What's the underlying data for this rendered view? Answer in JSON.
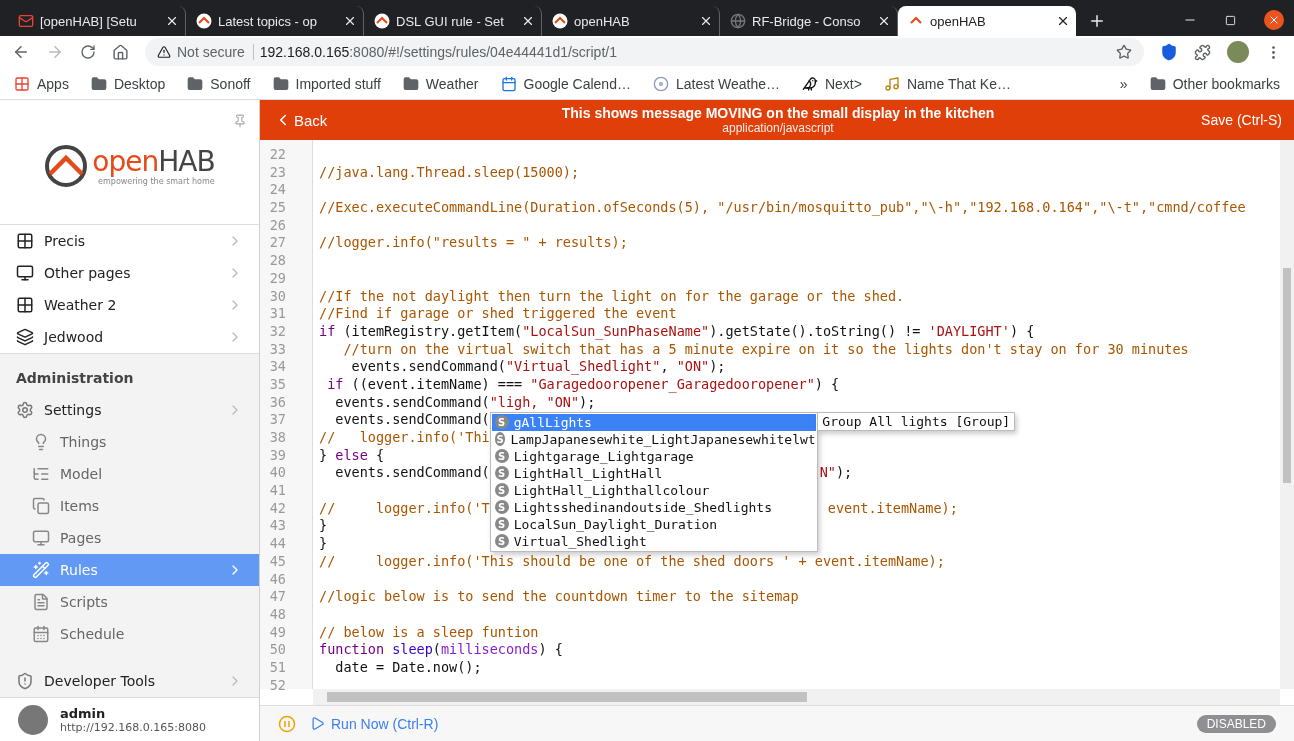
{
  "browser": {
    "tabs": [
      {
        "title": "[openHAB] [Setu",
        "kind": "mail",
        "selected": false
      },
      {
        "title": "Latest topics - op",
        "kind": "openhab",
        "selected": false
      },
      {
        "title": "DSL GUI rule - Set",
        "kind": "openhab",
        "selected": false
      },
      {
        "title": "openHAB",
        "kind": "openhab",
        "selected": false
      },
      {
        "title": "RF-Bridge - Conso",
        "kind": "globe",
        "selected": false
      },
      {
        "title": "openHAB",
        "kind": "openhab",
        "selected": true
      }
    ],
    "address": {
      "security": "Not secure",
      "host": "192.168.0.165",
      "path": ":8080/#!/settings/rules/04e44441d1/script/1"
    },
    "bookmarks": [
      {
        "label": "Apps",
        "kind": "apps"
      },
      {
        "label": "Desktop",
        "kind": "folder"
      },
      {
        "label": "Sonoff",
        "kind": "folder"
      },
      {
        "label": "Imported stuff",
        "kind": "folder"
      },
      {
        "label": "Weather",
        "kind": "folder"
      },
      {
        "label": "Google Calend…",
        "kind": "calendar"
      },
      {
        "label": "Latest Weathe…",
        "kind": "disc"
      },
      {
        "label": "Next>",
        "kind": "bird"
      },
      {
        "label": "Name That Ke…",
        "kind": "music"
      }
    ],
    "bookmarks_overflow": "»",
    "other_bookmarks": "Other bookmarks"
  },
  "sidebar": {
    "logo": {
      "word_1": "open",
      "word_2": "HAB",
      "tagline": "empowering the smart home"
    },
    "pages": [
      {
        "label": "Precis",
        "kind": "grid"
      },
      {
        "label": "Other pages",
        "kind": "monitor"
      },
      {
        "label": "Weather 2",
        "kind": "grid"
      },
      {
        "label": "Jedwood",
        "kind": "layers"
      }
    ],
    "admin_heading": "Administration",
    "settings": "Settings",
    "settings_items": [
      {
        "label": "Things",
        "kind": "bulb",
        "selected": false
      },
      {
        "label": "Model",
        "kind": "list",
        "selected": false
      },
      {
        "label": "Items",
        "kind": "copy",
        "selected": false
      },
      {
        "label": "Pages",
        "kind": "monitor",
        "selected": false
      },
      {
        "label": "Rules",
        "kind": "wand",
        "selected": true
      },
      {
        "label": "Scripts",
        "kind": "file",
        "selected": false
      },
      {
        "label": "Schedule",
        "kind": "calendar",
        "selected": false
      }
    ],
    "developer_tools": "Developer Tools",
    "user": {
      "name": "admin",
      "url": "http://192.168.0.165:8080"
    }
  },
  "header": {
    "back": "Back",
    "title": "This shows message MOVING on the small display in the kitchen",
    "subtitle": "application/javascript",
    "save": "Save (Ctrl-S)"
  },
  "editor": {
    "lines": [
      {
        "number": "22"
      },
      {
        "number": "23",
        "segments": [
          {
            "kind": "comment",
            "text": "//java.lang.Thread.sleep(15000);"
          }
        ]
      },
      {
        "number": "24"
      },
      {
        "number": "25",
        "segments": [
          {
            "kind": "comment",
            "text": "//Exec.executeCommandLine(Duration.ofSeconds(5), \"/usr/bin/mosquitto_pub\",\"\\-h\",\"192.168.0.164\",\"\\-t\",\"cmnd/coffee"
          }
        ]
      },
      {
        "number": "26"
      },
      {
        "number": "27",
        "segments": [
          {
            "kind": "comment",
            "text": "//logger.info(\"results = \" + results);"
          }
        ]
      },
      {
        "number": "28"
      },
      {
        "number": "29"
      },
      {
        "number": "30",
        "segments": [
          {
            "kind": "comment",
            "text": "//If the not daylight then turn the light on for the garage or the shed."
          }
        ]
      },
      {
        "number": "31",
        "segments": [
          {
            "kind": "comment",
            "text": "//Find if garage or shed triggered the event"
          }
        ]
      },
      {
        "number": "32",
        "segments": [
          {
            "kind": "keyword",
            "text": "if"
          },
          {
            "kind": "plain",
            "text": " (itemRegistry.getItem("
          },
          {
            "kind": "string",
            "text": "\"LocalSun_SunPhaseName\""
          },
          {
            "kind": "plain",
            "text": ").getState().toString() != "
          },
          {
            "kind": "string",
            "text": "'DAYLIGHT'"
          },
          {
            "kind": "plain",
            "text": ") {"
          }
        ]
      },
      {
        "number": "33",
        "segments": [
          {
            "kind": "comment",
            "text": "   //turn on the virtual switch that has a 5 minute expire on it so the lights don't stay on for 30 minutes"
          }
        ]
      },
      {
        "number": "34",
        "segments": [
          {
            "kind": "plain",
            "text": "    events.sendCommand("
          },
          {
            "kind": "string",
            "text": "\"Virtual_Shedlight\""
          },
          {
            "kind": "plain",
            "text": ", "
          },
          {
            "kind": "string",
            "text": "\"ON\""
          },
          {
            "kind": "plain",
            "text": ");"
          }
        ]
      },
      {
        "number": "35",
        "segments": [
          {
            "kind": "keyword",
            "text": " if"
          },
          {
            "kind": "plain",
            "text": " ((event.itemName) === "
          },
          {
            "kind": "string",
            "text": "\"Garagedooropener_Garagedooropener\""
          },
          {
            "kind": "plain",
            "text": ") {"
          }
        ]
      },
      {
        "number": "36",
        "segments": [
          {
            "kind": "plain",
            "text": "  events.sendCommand("
          },
          {
            "kind": "string",
            "text": "\"ligh, \"ON\""
          },
          {
            "kind": "plain",
            "text": ");"
          }
        ]
      },
      {
        "number": "37",
        "segments": [
          {
            "kind": "plain",
            "text": "  events.sendCommand("
          }
        ]
      },
      {
        "number": "38",
        "segments": [
          {
            "kind": "comment",
            "text": "//   logger.info('Thi"
          }
        ]
      },
      {
        "number": "39",
        "segments": [
          {
            "kind": "plain",
            "text": "} "
          },
          {
            "kind": "keyword",
            "text": "else"
          },
          {
            "kind": "plain",
            "text": " {"
          }
        ]
      },
      {
        "number": "40",
        "segments": [
          {
            "kind": "plain",
            "text": "  events.sendCommand("
          }
        ],
        "after_popup": [
          {
            "kind": "string",
            "text": "N\""
          },
          {
            "kind": "plain",
            "text": ");"
          }
        ]
      },
      {
        "number": "41"
      },
      {
        "number": "42",
        "segments": [
          {
            "kind": "comment",
            "text": "//     logger.info('T"
          }
        ],
        "after_popup": [
          {
            "kind": "comment",
            "text": " event.itemName);"
          }
        ]
      },
      {
        "number": "43",
        "segments": [
          {
            "kind": "plain",
            "text": "}"
          }
        ]
      },
      {
        "number": "44",
        "segments": [
          {
            "kind": "plain",
            "text": "}"
          }
        ]
      },
      {
        "number": "45",
        "segments": [
          {
            "kind": "comment",
            "text": "//     logger.info('This should be one of the shed doors ' + event.itemName);"
          }
        ]
      },
      {
        "number": "46"
      },
      {
        "number": "47",
        "segments": [
          {
            "kind": "comment",
            "text": "//logic below is to send the countdown timer to the sitemap"
          }
        ]
      },
      {
        "number": "48"
      },
      {
        "number": "49",
        "segments": [
          {
            "kind": "comment",
            "text": "// below is a sleep funtion"
          }
        ]
      },
      {
        "number": "50",
        "segments": [
          {
            "kind": "keyword",
            "text": "function "
          },
          {
            "kind": "def",
            "text": "sleep"
          },
          {
            "kind": "plain",
            "text": "("
          },
          {
            "kind": "variable",
            "text": "milliseconds"
          },
          {
            "kind": "plain",
            "text": ") {"
          }
        ]
      },
      {
        "number": "51",
        "segments": [
          {
            "kind": "plain",
            "text": "  date = Date.now();"
          }
        ]
      },
      {
        "number": "52"
      }
    ],
    "autocomplete": {
      "items": [
        {
          "badge": "S",
          "label": "gAllLights",
          "selected": true
        },
        {
          "badge": "S",
          "label": "LampJapanesewhite_LightJapanesewhitelwt",
          "selected": false
        },
        {
          "badge": "S",
          "label": "Lightgarage_Lightgarage",
          "selected": false
        },
        {
          "badge": "S",
          "label": "LightHall_LightHall",
          "selected": false
        },
        {
          "badge": "S",
          "label": "LightHall_Lighthallcolour",
          "selected": false
        },
        {
          "badge": "S",
          "label": "Lightsshedinandoutside_Shedlights",
          "selected": false
        },
        {
          "badge": "S",
          "label": "LocalSun_Daylight_Duration",
          "selected": false
        },
        {
          "badge": "S",
          "label": "Virtual_Shedlight",
          "selected": false
        }
      ],
      "hint": "Group All lights [Group]"
    }
  },
  "footer": {
    "run_now": "Run Now (Ctrl-R)",
    "status": "DISABLED"
  }
}
